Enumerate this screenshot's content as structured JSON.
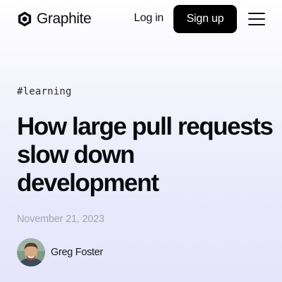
{
  "header": {
    "logo_text": "Graphite",
    "login_label": "Log in",
    "signup_label": "Sign up",
    "menu_icon": "hamburger-menu-icon"
  },
  "article": {
    "tag": "#learning",
    "title": "How large pull requests slow down development",
    "date": "November 21, 2023",
    "author": {
      "name": "Greg Foster",
      "avatar_icon": "author-avatar"
    }
  },
  "colors": {
    "button_bg": "#000000",
    "date_text": "#a4a4b1",
    "background_top": "#ffffff",
    "background_bottom": "#e6e5fb"
  }
}
